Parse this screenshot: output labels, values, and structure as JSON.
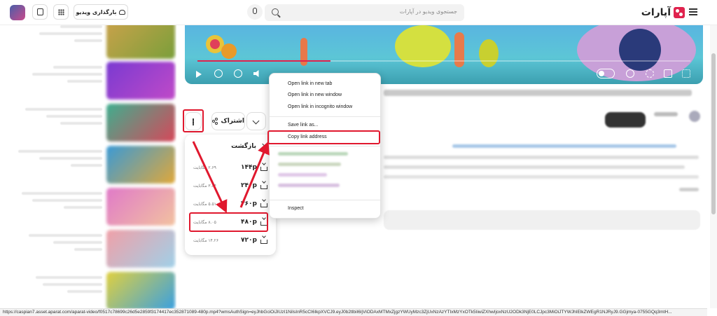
{
  "header": {
    "logo_text": "آپارات",
    "search_placeholder": "جستجوی ویدیو در آپارات",
    "upload_label": "بارگذاری ویدیو"
  },
  "player": {
    "progress_fraction": 0.27
  },
  "actions": {
    "share_label": "اشتراک"
  },
  "download_panel": {
    "back_label": "بازگشت",
    "options": [
      {
        "resolution": "۱۴۴p",
        "size": "۲.۶۹ مگابایت"
      },
      {
        "resolution": "۲۴۰p",
        "size": "۳.۸۴ مگابایت"
      },
      {
        "resolution": "۳۶۰p",
        "size": "۵.۵۱ مگابایت"
      },
      {
        "resolution": "۴۸۰p",
        "size": "۸.۰۵ مگابایت"
      },
      {
        "resolution": "۷۲۰p",
        "size": "۱۴.۲۶ مگابایت"
      }
    ]
  },
  "context_menu": {
    "items": [
      "Open link in new tab",
      "Open link in new window",
      "Open link in incognito window",
      "Save link as...",
      "Copy link address",
      "Inspect"
    ]
  },
  "status_bar": {
    "url": "https://caspian7.asset.aparat.com/aparat-video/f0517c78699c26d5e2859f3174417ec352871089-480p.mp4?wmsAuthSign=eyJhbGciOiJIUzI1NiIsInR5cCI6IkpXVCJ9.eyJ0b2tlbiI6IjViODAxMTMxZjgzYWUyMzc3ZjUxNzAzYTIxMzYxOTk5IiwiZXhwIjoxNzU2ODk3NjE0LCJpc3MiOiJTYWJhIElkZWEgR1NJRyJ9.GGjmya-0755GQq3mtH..."
  },
  "colors": {
    "accent": "#e0234e",
    "highlight": "#e0182e"
  }
}
